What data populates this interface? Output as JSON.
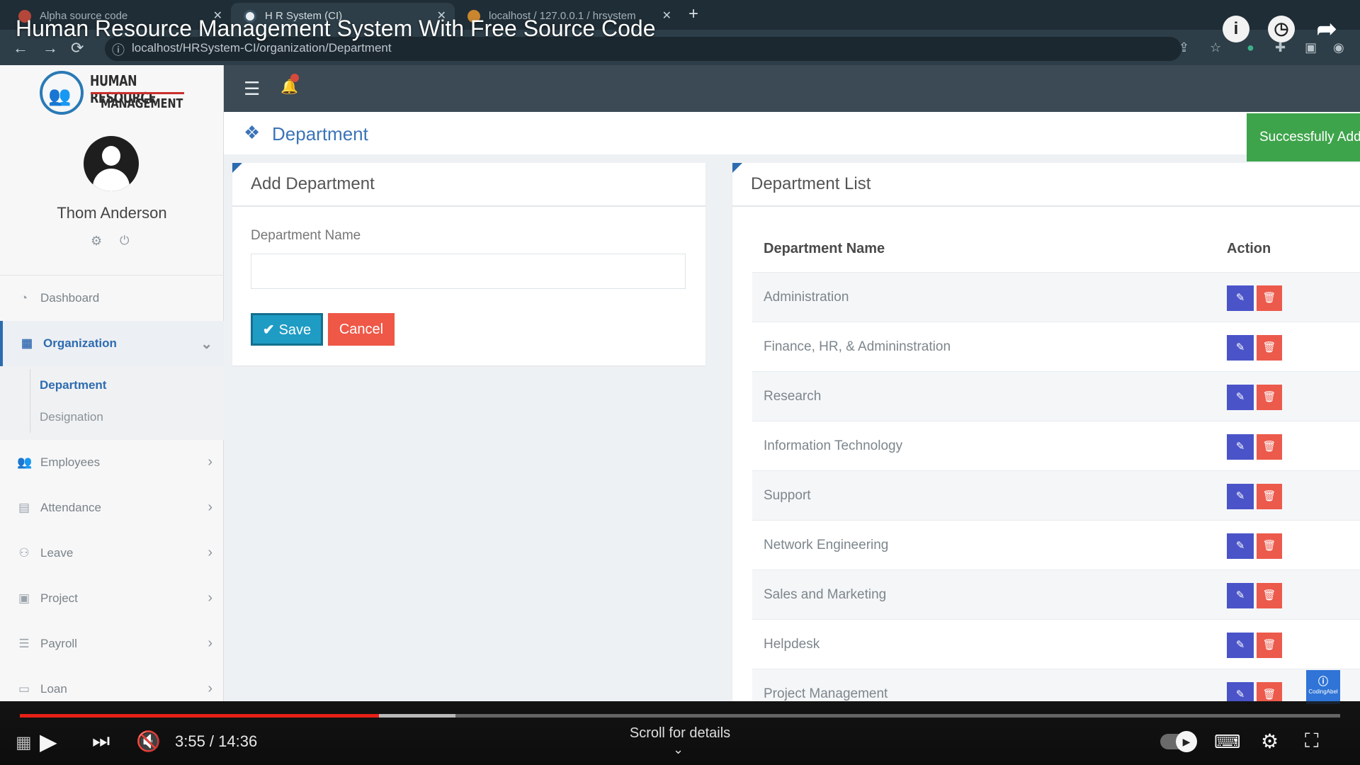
{
  "browser": {
    "tabs": [
      {
        "label": "Alpha source code"
      },
      {
        "label": "H R System (CI)"
      },
      {
        "label": "localhost / 127.0.0.1 / hrsystem"
      }
    ],
    "url": "localhost/HRSystem-CI/organization/Department"
  },
  "video": {
    "title": "Human Resource Management System With Free Source Code",
    "time": "3:55 / 14:36",
    "progress": 0.272,
    "buffered": 0.33,
    "scroll_hint": "Scroll for details"
  },
  "app": {
    "logo": {
      "line1": "HUMAN RESOURCE",
      "line2": "MANAGEMENT"
    },
    "user": {
      "name": "Thom Anderson"
    },
    "menu": [
      {
        "label": "Dashboard",
        "icon": "dashboard-icon"
      },
      {
        "label": "Organization",
        "icon": "building-icon",
        "active": true,
        "submenu": [
          {
            "label": "Department",
            "active": true
          },
          {
            "label": "Designation"
          }
        ]
      },
      {
        "label": "Employees",
        "icon": "users-icon"
      },
      {
        "label": "Attendance",
        "icon": "clipboard-icon"
      },
      {
        "label": "Leave",
        "icon": "user-leave-icon"
      },
      {
        "label": "Project",
        "icon": "briefcase-icon"
      },
      {
        "label": "Payroll",
        "icon": "list-icon"
      },
      {
        "label": "Loan",
        "icon": "money-icon"
      }
    ],
    "page_title": "Department",
    "toast": "Successfully Added",
    "add_form": {
      "title": "Add Department",
      "field_label": "Department Name",
      "field_value": "",
      "save_label": "Save",
      "cancel_label": "Cancel"
    },
    "list": {
      "title": "Department List",
      "columns": [
        "Department Name",
        "Action"
      ],
      "rows": [
        "Administration",
        "Finance, HR, & Admininstration",
        "Research",
        "Information Technology",
        "Support",
        "Network Engineering",
        "Sales and Marketing",
        "Helpdesk",
        "Project Management"
      ]
    },
    "colors": {
      "accent": "#2d6bb0",
      "save": "#1e9cc4",
      "cancel": "#ef5747",
      "edit": "#4a54c8",
      "delete": "#ec5a4c",
      "toast": "#3ea44b"
    }
  },
  "watermark": {
    "text": "CodingAbel"
  }
}
